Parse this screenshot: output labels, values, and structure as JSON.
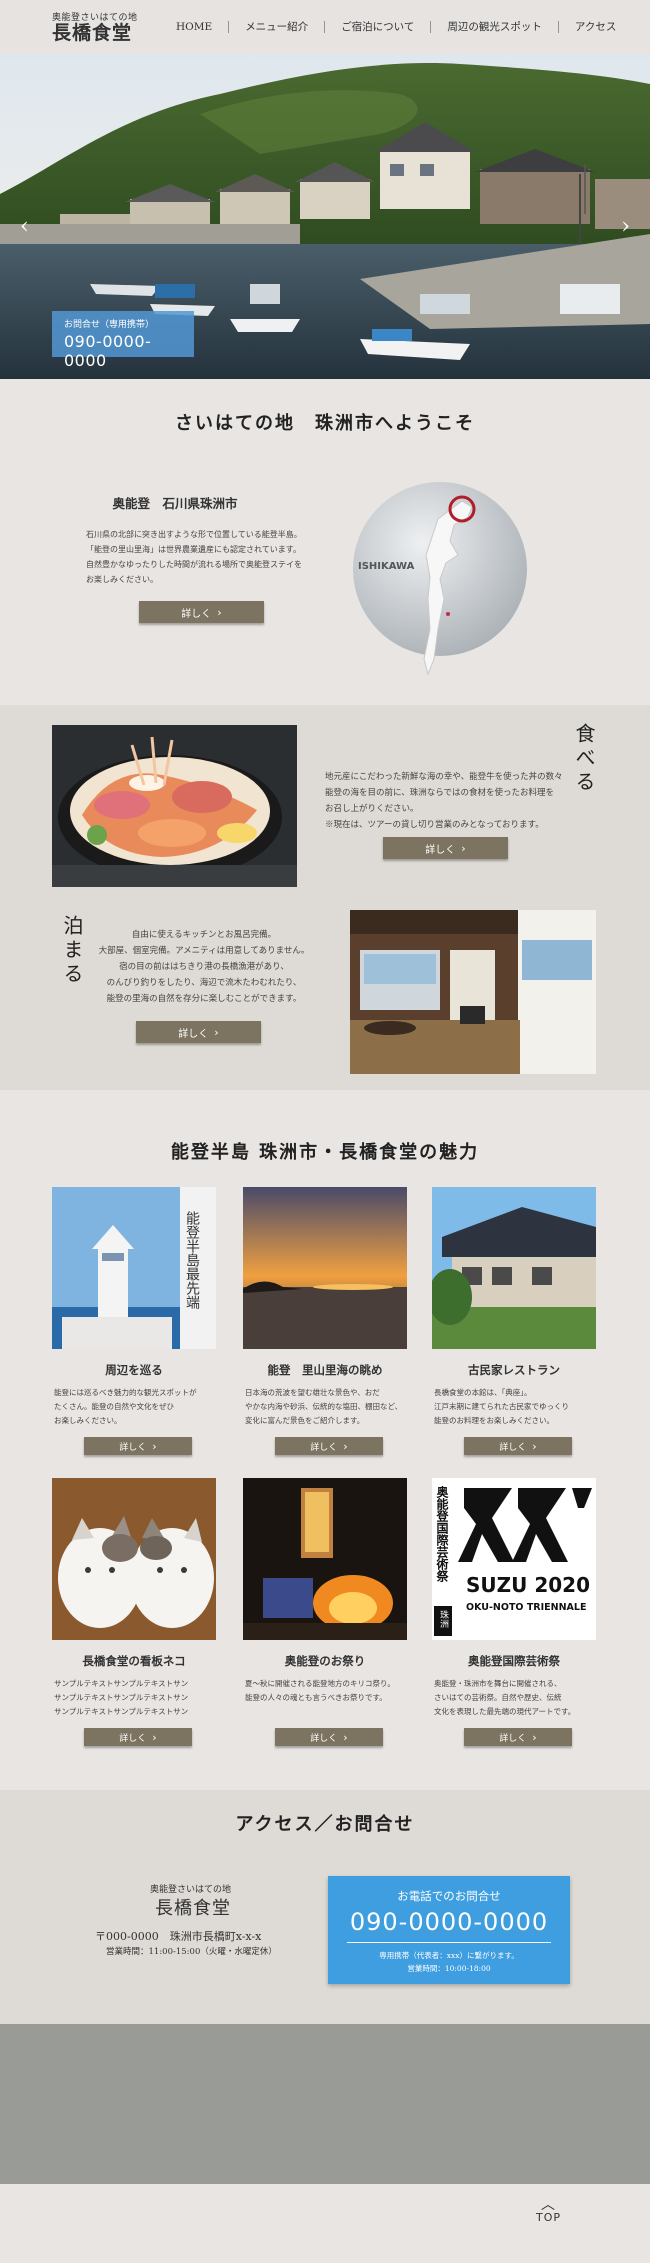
{
  "header": {
    "logo_sub": "奥能登さいはての地",
    "logo_main": "長橋食堂",
    "nav": [
      "HOME",
      "メニュー紹介",
      "ご宿泊について",
      "周辺の観光スポット",
      "アクセス"
    ]
  },
  "hero": {
    "contact_title": "お問合せ（専用携帯）",
    "contact_number": "090-0000-0000",
    "prev_icon": "chevron-left-icon",
    "next_icon": "chevron-right-icon"
  },
  "welcome": {
    "title": "さいはての地　珠洲市へようこそ",
    "subtitle": "奥能登　石川県珠洲市",
    "desc": [
      "石川県の北部に突き出すような形で位置している能登半島。",
      "「能登の里山里海」は世界農業遺産にも認定されています。",
      "自然豊かなゆったりした時間が流れる場所で奥能登ステイを",
      "お楽しみください。"
    ],
    "button": "詳しく",
    "map_label": "ISHIKAWA"
  },
  "food": {
    "title": "食べる",
    "desc": [
      "地元産にこだわった新鮮な海の幸や、能登牛を使った丼の数々",
      "能登の海を目の前に、珠洲ならではの食材を使ったお料理を",
      "お召し上がりください。",
      "※現在は、ツアーの貸し切り営業のみとなっております。"
    ],
    "button": "詳しく"
  },
  "stay": {
    "title": "泊まる",
    "desc": [
      "自由に使えるキッチンとお風呂完備。",
      "大部屋、個室完備。アメニティは用意してありません。",
      "宿の目の前ははちきり港の長橋漁港があり、",
      "のんびり釣りをしたり、海辺で流木たわむれたり、",
      "能登の里海の自然を存分に楽しむことができます。"
    ],
    "button": "詳しく"
  },
  "attractions": {
    "title": "能登半島 珠洲市・長橋食堂の魅力",
    "cards": [
      {
        "caption": "周辺を巡る",
        "text": [
          "能登には巡るべき魅力的な観光スポットが",
          "たくさん。能登の自然や文化をぜひ",
          "お楽しみください。"
        ],
        "button": "詳しく"
      },
      {
        "caption": "能登　里山里海の眺め",
        "text": [
          "日本海の荒波を望む雄壮な景色や、おだ",
          "やかな内海や砂浜、伝統的な塩田、棚田など、",
          "変化に富んだ景色をご紹介します。"
        ],
        "button": "詳しく"
      },
      {
        "caption": "古民家レストラン",
        "text": [
          "長橋食堂の本館は、「典座」。",
          "江戸末期に建てられた古民家でゆっくり",
          "能登のお料理をお楽しみください。"
        ],
        "button": "詳しく"
      },
      {
        "caption": "長橋食堂の看板ネコ",
        "text": [
          "サンプルテキストサンプルテキストサン",
          "サンプルテキストサンプルテキストサン",
          "サンプルテキストサンプルテキストサン"
        ],
        "button": "詳しく"
      },
      {
        "caption": "奥能登のお祭り",
        "text": [
          "夏～秋に開催される能登地方のキリコ祭り。",
          "能登の人々の魂とも言うべきお祭りです。"
        ],
        "button": "詳しく"
      },
      {
        "caption": "奥能登国際芸術祭",
        "text": [
          "奥能登・珠洲市を舞台に開催される、",
          "さいはての芸術祭。自然や歴史、伝統",
          "文化を表現した最先端の現代アートです。"
        ],
        "button": "詳しく"
      }
    ],
    "lighthouse_sign": "能登半島最先端",
    "art_poster": {
      "kanji": "奥能登国際芸術祭",
      "tag": "珠洲",
      "year": "SUZU 2020",
      "name": "OKU-NOTO TRIENNALE"
    }
  },
  "access": {
    "title": "アクセス／お問合せ",
    "sub": "奥能登さいはての地",
    "name": "長橋食堂",
    "address": "〒000-0000　珠洲市長橋町x-x-x",
    "hours": "営業時間：11:00-15:00（火曜・水曜定休）",
    "phone_title": "お電話でのお問合せ",
    "phone_number": "090-0000-0000",
    "phone_note": "専用携帯（代表者：xxx）に繋がります。",
    "phone_hours": "営業時間：10:00-18:00"
  },
  "footer": {
    "top": "TOP"
  }
}
